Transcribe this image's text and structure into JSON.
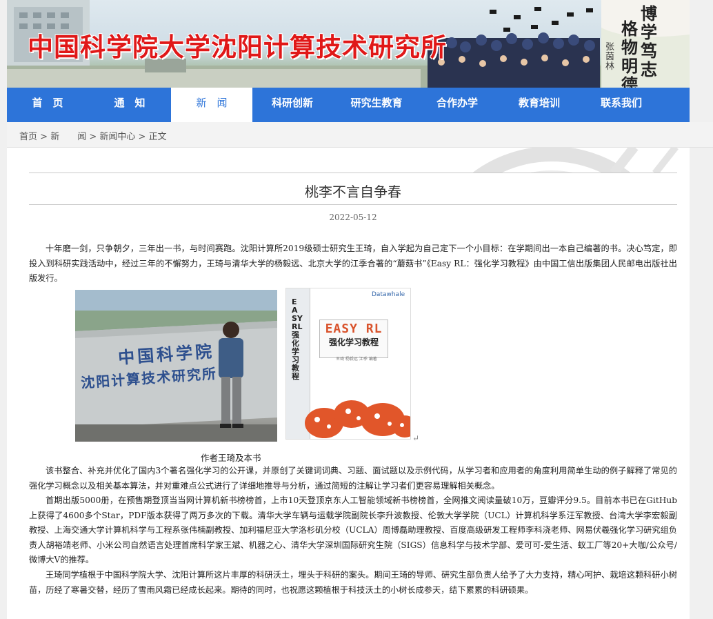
{
  "banner": {
    "title": "中国科学院大学沈阳计算技术研究所",
    "motto_col1": "博学笃志",
    "motto_col2": "格物明德",
    "motto_sign": "张茵林"
  },
  "nav": {
    "items": [
      {
        "label": "首　页",
        "active": false
      },
      {
        "label": "通　知",
        "active": false
      },
      {
        "label": "新　闻",
        "active": true
      },
      {
        "label": "科研创新",
        "active": false
      },
      {
        "label": "研究生教育",
        "active": false
      },
      {
        "label": "合作办学",
        "active": false
      },
      {
        "label": "教育培训",
        "active": false
      },
      {
        "label": "联系我们",
        "active": false
      }
    ]
  },
  "breadcrumb": {
    "home": "首页",
    "sep1": " > ",
    "news": "新　　闻",
    "sep2": " > ",
    "center": "新闻中心",
    "sep3": " > ",
    "current": "正文"
  },
  "article": {
    "title": "桃李不言自争春",
    "date": "2022-05-12",
    "p1": "十年磨一剑，只争朝夕，三年出一书，与时间赛跑。沈阳计算所2019级硕士研究生王琦，自入学起为自己定下一个小目标：在学期间出一本自己编著的书。决心笃定，即投入到科研实践活动中，经过三年的不懈努力，王琦与清华大学的杨毅远、北京大学的江季合著的“蘑菇书”《Easy RL：强化学习教程》由中国工信出版集团人民邮电出版社出版发行。",
    "photo1_sign_line1": "中国科学院",
    "photo1_sign_line2": "沈阳计算技术研究所",
    "book_title_en": "EASY RL",
    "book_title_cn": "强化学习教程",
    "book_authors": "王琦 杨毅远 江季 编著",
    "book_spine": "EASY RL 强化学习教程",
    "book_logo": "Datawhale",
    "caption": "作者王琦及本书",
    "return_mark": "↵",
    "p2": "该书整合、补充并优化了国内3个著名强化学习的公开课，并原创了关键词词典、习题、面试题以及示例代码，从学习者和应用者的角度利用简单生动的例子解释了常见的强化学习概念以及相关基本算法，并对重难点公式进行了详细地推导与分析，通过简短的注解让学习者们更容易理解相关概念。",
    "p3": "首期出版5000册，在预售期登顶当当网计算机新书榜榜首，上市10天登顶京东人工智能领域新书榜榜首，全网推文阅读量破10万，豆瓣评分9.5。目前本书已在GitHub上获得了4600多个Star，PDF版本获得了两万多次的下载。清华大学车辆与运载学院副院长李升波教授、伦敦大学学院（UCL）计算机科学系汪军教授、台湾大学李宏毅副教授、上海交通大学计算机科学与工程系张伟楠副教授、加利福尼亚大学洛杉矶分校（UCLA）周博磊助理教授、百度高级研发工程师李科浇老师、网易伏羲强化学习研究组负责人胡裕靖老师、小米公司自然语言处理首席科学家王斌、机器之心、清华大学深圳国际研究生院（SIGS）信息科学与技术学部、爱可可-爱生活、蚁工厂等20+大咖/公众号/微博大V的推荐。",
    "p4": "王琦同学植根于中国科学院大学、沈阳计算所这片丰厚的科研沃土，埋头于科研的案头。期间王琦的导师、研究生部负责人给予了大力支持，精心呵护、栽培这颗科研小树苗，历经了寒暑交替，经历了雪雨风霜已经成长起来。期待的同时，也祝愿这颗植根于科技沃土的小树长成参天，结下累累的科研硕果。"
  },
  "colors": {
    "nav_bg": "#2d74d9",
    "banner_title": "#e01818",
    "page_bg": "#f0f0f0"
  }
}
